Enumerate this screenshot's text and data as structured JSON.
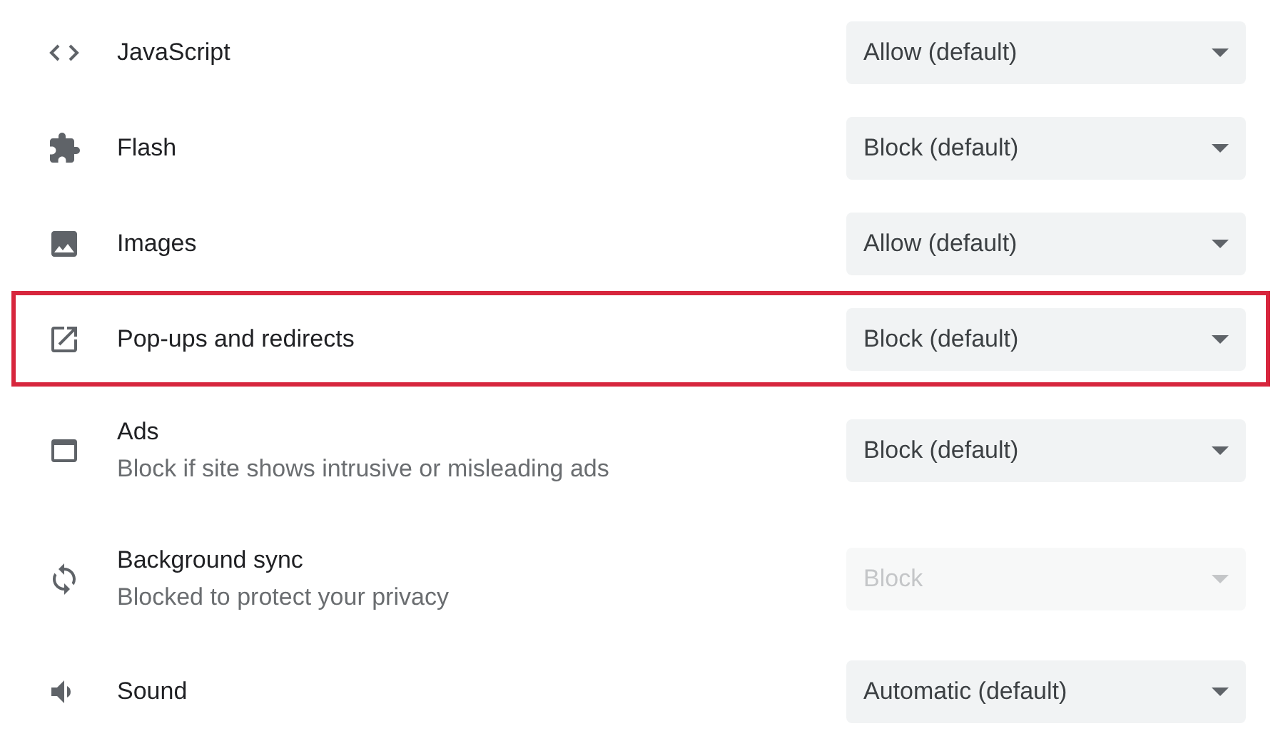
{
  "settings": [
    {
      "label": "JavaScript",
      "value": "Allow (default)",
      "disabled": false,
      "highlighted": false
    },
    {
      "label": "Flash",
      "value": "Block (default)",
      "disabled": false,
      "highlighted": false
    },
    {
      "label": "Images",
      "value": "Allow (default)",
      "disabled": false,
      "highlighted": false
    },
    {
      "label": "Pop-ups and redirects",
      "value": "Block (default)",
      "disabled": false,
      "highlighted": true
    },
    {
      "label": "Ads",
      "description": "Block if site shows intrusive or misleading ads",
      "value": "Block (default)",
      "disabled": false,
      "highlighted": false
    },
    {
      "label": "Background sync",
      "description": "Blocked to protect your privacy",
      "value": "Block",
      "disabled": true,
      "highlighted": false
    },
    {
      "label": "Sound",
      "value": "Automatic (default)",
      "disabled": false,
      "highlighted": false
    }
  ]
}
